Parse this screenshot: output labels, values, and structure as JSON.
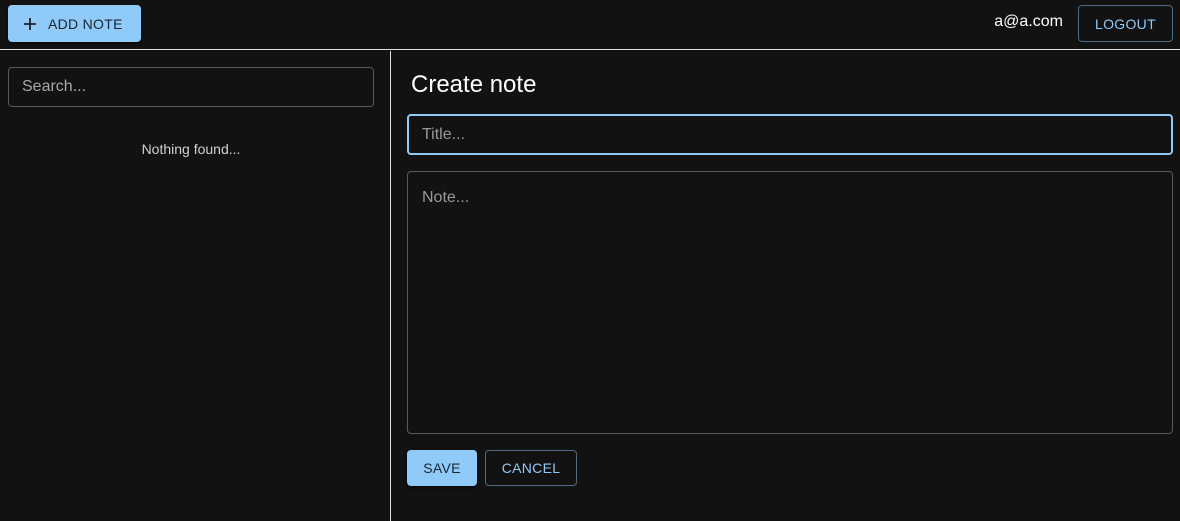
{
  "topbar": {
    "add_note_label": "ADD NOTE",
    "add_icon": "plus-icon",
    "user_email": "a@a.com",
    "logout_label": "LOGOUT"
  },
  "sidebar": {
    "search_placeholder": "Search...",
    "search_value": "",
    "empty_message": "Nothing found..."
  },
  "editor": {
    "heading": "Create note",
    "title_placeholder": "Title...",
    "title_value": "",
    "note_placeholder": "Note...",
    "note_value": "",
    "save_label": "SAVE",
    "cancel_label": "CANCEL"
  },
  "colors": {
    "background": "#121212",
    "accent": "#90caf9",
    "border": "#5a5a5a",
    "divider": "#e0e0e0"
  }
}
